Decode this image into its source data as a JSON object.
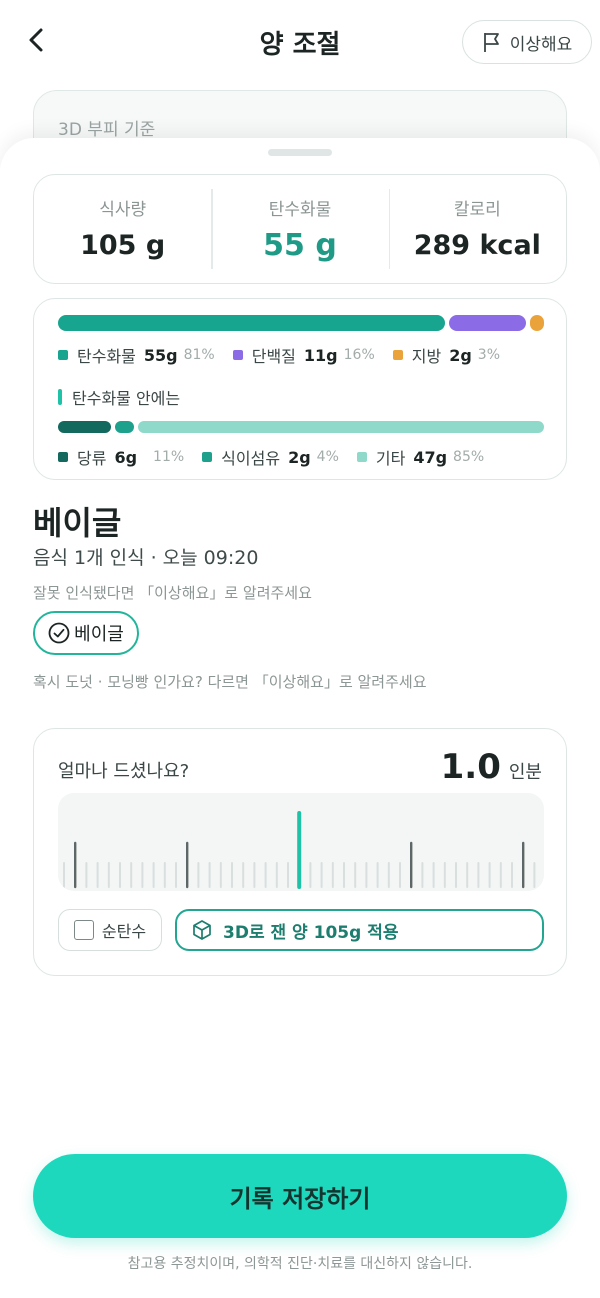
{
  "header": {
    "title": "양 조절",
    "report_label": "이상해요"
  },
  "under_card": {
    "label": "3D 부피 기준"
  },
  "stats": [
    {
      "label": "식사량",
      "value": "105 g"
    },
    {
      "label": "탄수화물",
      "value": "55 g"
    },
    {
      "label": "칼로리",
      "value": "289 kcal"
    }
  ],
  "macros": {
    "items": [
      {
        "name": "탄수화물",
        "grams": "55g",
        "pct": "81%",
        "color": "#17a58f",
        "fraction": 0.81
      },
      {
        "name": "단백질",
        "grams": "11g",
        "pct": "16%",
        "color": "#8b6be6",
        "fraction": 0.16
      },
      {
        "name": "지방",
        "grams": "2g",
        "pct": "3%",
        "color": "#eaa33a",
        "fraction": 0.03
      }
    ],
    "sub_title": "탄수화물 안에는",
    "carb_items": [
      {
        "name": "당류",
        "grams": "6g",
        "pct": "11%",
        "color": "#13695e",
        "fraction": 0.11
      },
      {
        "name": "식이섬유",
        "grams": "2g",
        "pct": "4%",
        "color": "#1ea18c",
        "fraction": 0.04
      },
      {
        "name": "기타",
        "grams": "47g",
        "pct": "85%",
        "color": "#8ed9ca",
        "fraction": 0.85
      }
    ]
  },
  "food": {
    "name": "베이글",
    "recognition": "음식 1개 인식 · 오늘 09:20",
    "hint": "잘못 인식됐다면 「이상해요」로 알려주세요",
    "chip_label": "베이글",
    "alt_hint": "혹시 도넛 · 모닝빵 인가요? 다르면 「이상해요」로 알려주세요"
  },
  "portion": {
    "question": "얼마나 드셨나요?",
    "value": "1.0",
    "unit": "인분",
    "pure_carb_label": "순탄수",
    "apply_label": "3D로 잰 양 105g 적용"
  },
  "footer": {
    "save_label": "기록 저장하기",
    "disclaimer": "참고용 추정치이며, 의학적 진단·치료를 대신하지 않습니다."
  },
  "colors": {
    "accent": "#1ed8bd",
    "accent_dark": "#1e9a86"
  },
  "icons": {
    "back": "chevron-left-icon",
    "report": "flag-icon",
    "chip": "check-circle-icon",
    "apply": "cube-icon"
  }
}
